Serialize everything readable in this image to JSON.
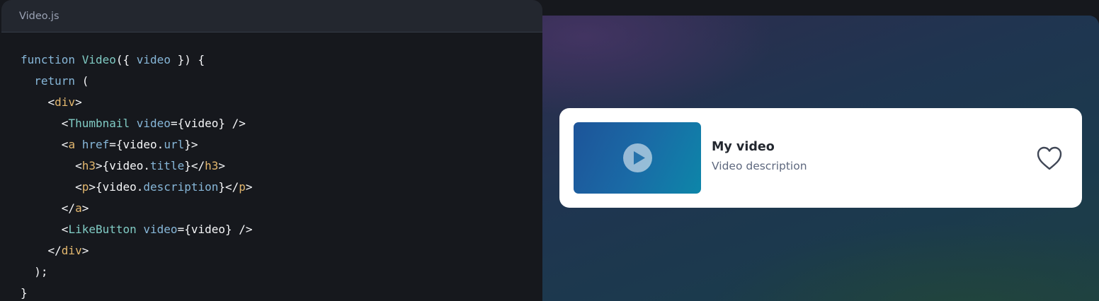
{
  "code": {
    "filename": "Video.js",
    "lines": [
      [
        [
          "function ",
          "keyword"
        ],
        [
          "Video",
          "fn"
        ],
        [
          "({ ",
          "punc"
        ],
        [
          "video",
          "param"
        ],
        [
          " }) {",
          "punc"
        ]
      ],
      [
        [
          "  return ",
          "keyword"
        ],
        [
          "(",
          "punc"
        ]
      ],
      [
        [
          "    <",
          "punc"
        ],
        [
          "div",
          "tag"
        ],
        [
          ">",
          "punc"
        ]
      ],
      [
        [
          "      <",
          "punc"
        ],
        [
          "Thumbnail",
          "component"
        ],
        [
          " video",
          "attr"
        ],
        [
          "={",
          "punc"
        ],
        [
          "video",
          "text"
        ],
        [
          "} />",
          "punc"
        ]
      ],
      [
        [
          "      <",
          "punc"
        ],
        [
          "a",
          "tag"
        ],
        [
          " href",
          "attr"
        ],
        [
          "={",
          "punc"
        ],
        [
          "video.",
          "text"
        ],
        [
          "url",
          "prop"
        ],
        [
          "}>",
          "punc"
        ]
      ],
      [
        [
          "        <",
          "punc"
        ],
        [
          "h3",
          "tag"
        ],
        [
          ">{",
          "punc"
        ],
        [
          "video.",
          "text"
        ],
        [
          "title",
          "prop"
        ],
        [
          "}</",
          "punc"
        ],
        [
          "h3",
          "tag"
        ],
        [
          ">",
          "punc"
        ]
      ],
      [
        [
          "        <",
          "punc"
        ],
        [
          "p",
          "tag"
        ],
        [
          ">{",
          "punc"
        ],
        [
          "video.",
          "text"
        ],
        [
          "description",
          "prop"
        ],
        [
          "}</",
          "punc"
        ],
        [
          "p",
          "tag"
        ],
        [
          ">",
          "punc"
        ]
      ],
      [
        [
          "      </",
          "punc"
        ],
        [
          "a",
          "tag"
        ],
        [
          ">",
          "punc"
        ]
      ],
      [
        [
          "      <",
          "punc"
        ],
        [
          "LikeButton",
          "component"
        ],
        [
          " video",
          "attr"
        ],
        [
          "={",
          "punc"
        ],
        [
          "video",
          "text"
        ],
        [
          "} />",
          "punc"
        ]
      ],
      [
        [
          "    </",
          "punc"
        ],
        [
          "div",
          "tag"
        ],
        [
          ">",
          "punc"
        ]
      ],
      [
        [
          "  );",
          "punc"
        ]
      ],
      [
        [
          "}",
          "punc"
        ]
      ]
    ]
  },
  "preview": {
    "video": {
      "title": "My video",
      "description": "Video description"
    },
    "icons": {
      "thumbnail_icon": "play-icon",
      "like_icon": "heart-icon"
    }
  },
  "colors": {
    "code_background": "#16181d",
    "tab_bar": "#23272f",
    "card_background": "#ffffff",
    "title_text": "#23272f",
    "description_text": "#5e687e"
  }
}
